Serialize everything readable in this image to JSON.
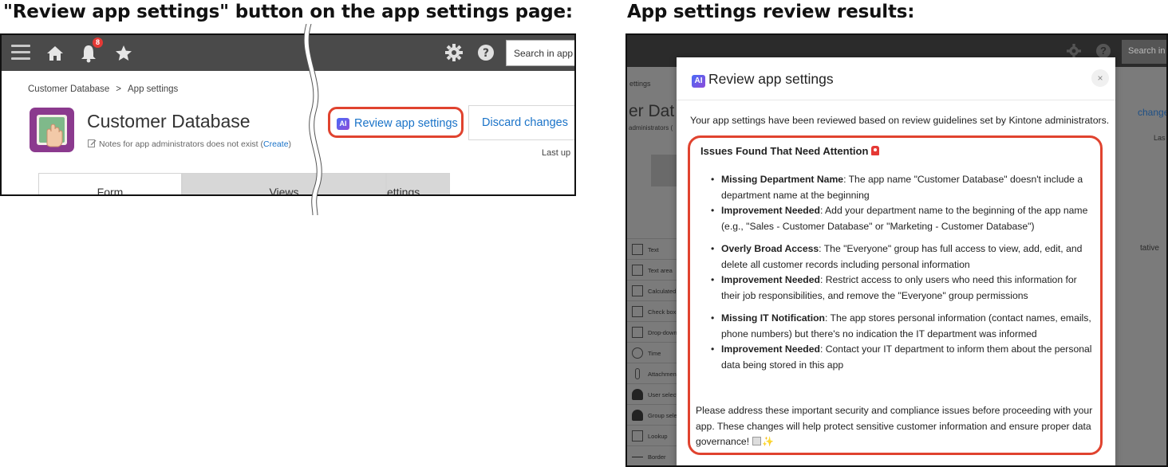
{
  "captions": {
    "left": "\"Review app settings\" button on the app settings page:",
    "right": "App settings review results:"
  },
  "left_panel": {
    "notification_count": "8",
    "search_placeholder": "Search in app",
    "breadcrumb": {
      "root": "Customer Database",
      "sep": ">",
      "current": "App settings"
    },
    "app_title": "Customer Database",
    "notes_text": "Notes for app administrators does not exist (",
    "notes_link": "Create",
    "notes_end": ")",
    "review_button": "Review app settings",
    "ai_badge": "AI",
    "discard_button": "Discard changes",
    "last_updated": "Last up",
    "tabs": [
      "Form",
      "Views",
      "ettings"
    ]
  },
  "right_panel": {
    "bg_search": "Search in",
    "bg_texts": {
      "settings_crumb": "ettings",
      "title_fragment": "er Dat",
      "admins_fragment": "administrators (",
      "change_fragment": "change",
      "last_fragment": "Las",
      "tative_fragment": "tative"
    },
    "palette": [
      "Text",
      "Text area",
      "Calculated",
      "Check box",
      "Drop-down",
      "Time",
      "Attachment",
      "User selection",
      "Group selection",
      "Lookup",
      "Border"
    ],
    "modal": {
      "ai_badge": "AI",
      "title": "Review app settings",
      "close_glyph": "×",
      "intro": "Your app settings have been reviewed based on review guidelines set by Kintone administrators.",
      "issues_heading": "Issues Found That Need Attention",
      "issues": [
        {
          "label": "Missing Department Name",
          "text": ": The app name \"Customer Database\" doesn't include a department name at the beginning"
        },
        {
          "label": "Improvement Needed",
          "text": ": Add your department name to the beginning of the app name (e.g., \"Sales - Customer Database\" or \"Marketing - Customer Database\")"
        },
        {
          "label": "Overly Broad Access",
          "text": ": The \"Everyone\" group has full access to view, add, edit, and delete all customer records including personal information"
        },
        {
          "label": "Improvement Needed",
          "text": ": Restrict access to only users who need this information for their job responsibilities, and remove the \"Everyone\" group permissions"
        },
        {
          "label": "Missing IT Notification",
          "text": ": The app stores personal information (contact names, emails, phone numbers) but there's no indication the IT department was informed"
        },
        {
          "label": "Improvement Needed",
          "text": ": Contact your IT department to inform them about the personal data being stored in this app"
        }
      ],
      "closing": "Please address these important security and compliance issues before proceeding with your app. These changes will help protect sensitive customer information and ensure proper data governance!"
    }
  },
  "colors": {
    "highlight_ring": "#e0432f",
    "link_blue": "#1a73c8",
    "topbar": "#4a4a4a",
    "app_icon": "#8b3a8e"
  }
}
